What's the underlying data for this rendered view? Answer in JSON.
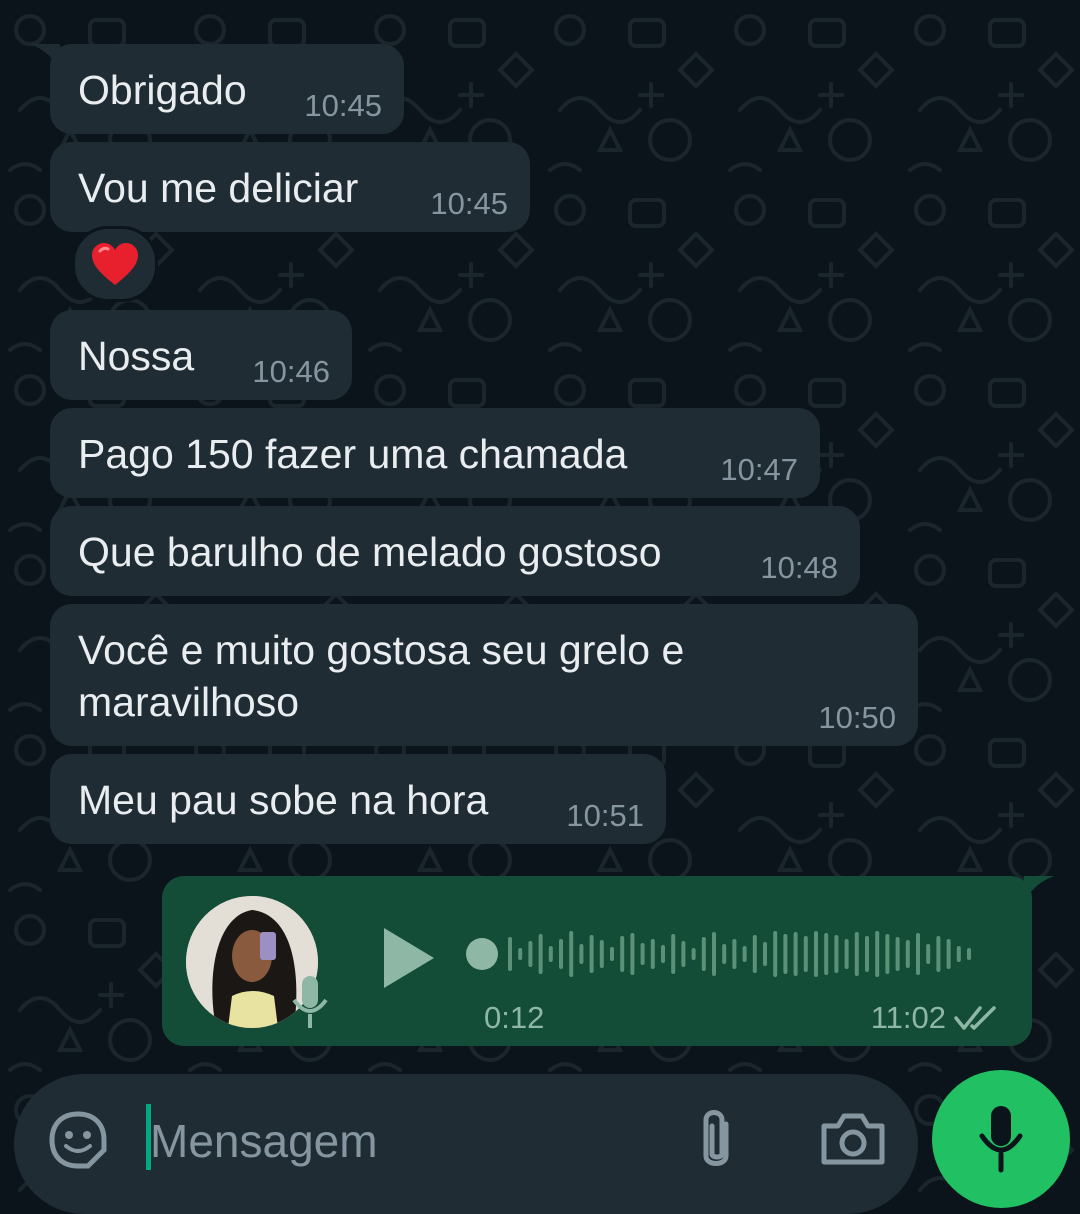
{
  "messages": [
    {
      "text": "Obrigado",
      "time": "10:45"
    },
    {
      "text": "Vou me deliciar",
      "time": "10:45"
    },
    {
      "text": "Nossa",
      "time": "10:46"
    },
    {
      "text": "Pago 150 fazer uma chamada",
      "time": "10:47"
    },
    {
      "text": "Que barulho de melado gostoso",
      "time": "10:48"
    },
    {
      "text_line1": "Você e muito gostosa seu grelo e",
      "text_line2": "maravilhoso",
      "time": "10:50"
    },
    {
      "text": "Meu pau sobe na hora",
      "time": "10:51"
    }
  ],
  "reaction": {
    "emoji": "❤️"
  },
  "voice_message": {
    "duration": "0:12",
    "time": "11:02",
    "status_icon": "double-check-icon",
    "progress": 0
  },
  "composer": {
    "placeholder": "Mensagem",
    "icons": [
      "sticker-icon",
      "attach-icon",
      "camera-icon",
      "mic-icon"
    ]
  },
  "colors": {
    "background": "#0b141a",
    "incoming_bubble": "#1f2c34",
    "outgoing_bubble": "#144d37",
    "accent": "#21c063",
    "text_primary": "#e9edef",
    "text_secondary": "#8696a0"
  }
}
